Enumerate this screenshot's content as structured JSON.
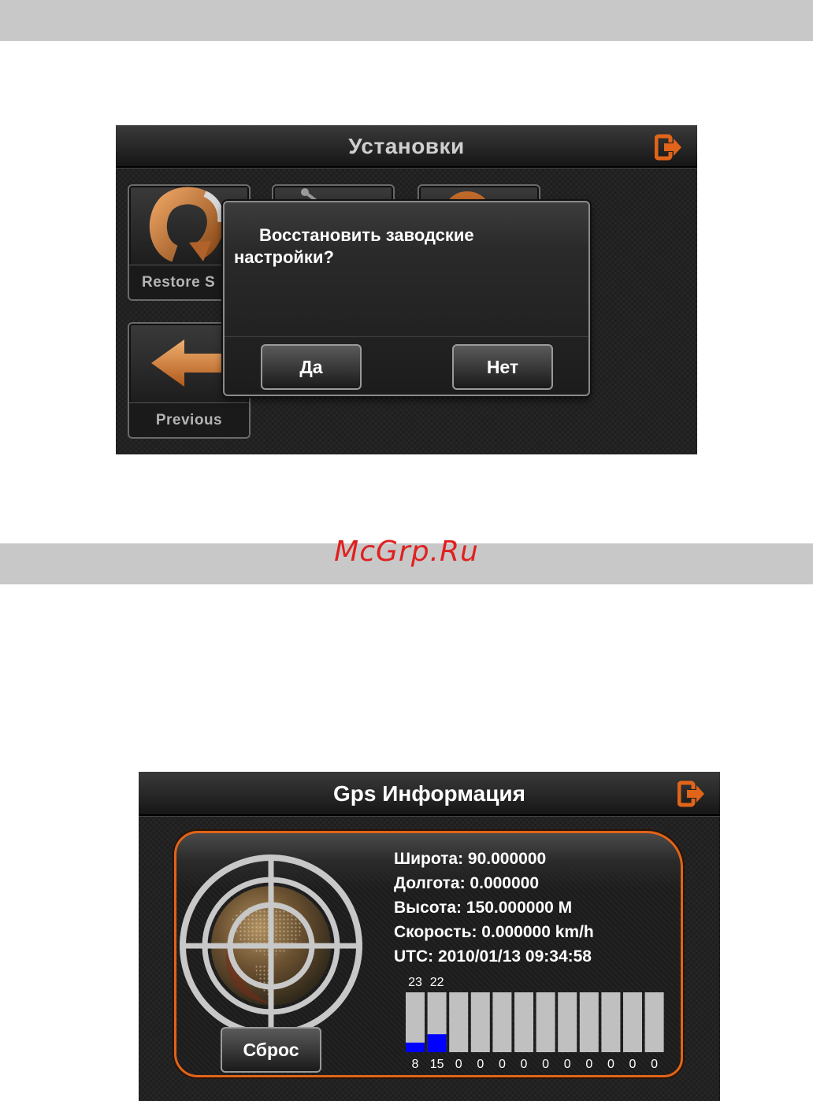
{
  "watermark": "McGrp.Ru",
  "settings_screen": {
    "title": "Установки",
    "exit_icon": "exit-icon",
    "tiles": [
      {
        "label": "Restore S",
        "icon": "restore-arrow-icon"
      },
      {
        "label": "",
        "icon": "tool-icon"
      },
      {
        "label": "",
        "icon": "settings-icon"
      },
      {
        "label": "Previous",
        "icon": "back-arrow-icon"
      }
    ],
    "dialog": {
      "message": "Восстановить заводские настройки?",
      "yes_label": "Да",
      "no_label": "Нет"
    }
  },
  "gps_screen": {
    "title": "Gps Информация",
    "exit_icon": "exit-icon",
    "latitude_line": "Широта: 90.000000",
    "longitude_line": "Долгота: 0.000000",
    "altitude_line": "Высота: 150.000000 M",
    "speed_line": "Скорость: 0.000000 km/h",
    "utc_line": "UTC: 2010/01/13 09:34:58",
    "reset_label": "Сброс",
    "colors": {
      "accent": "#e0641a",
      "signal": "#0000ff",
      "bar_bg": "#c0c0c0"
    },
    "satellites": {
      "ids": [
        "23",
        "22",
        "",
        "",
        "",
        "",
        "",
        "",
        "",
        "",
        "",
        ""
      ],
      "signal": [
        8,
        15,
        0,
        0,
        0,
        0,
        0,
        0,
        0,
        0,
        0,
        0
      ]
    }
  }
}
